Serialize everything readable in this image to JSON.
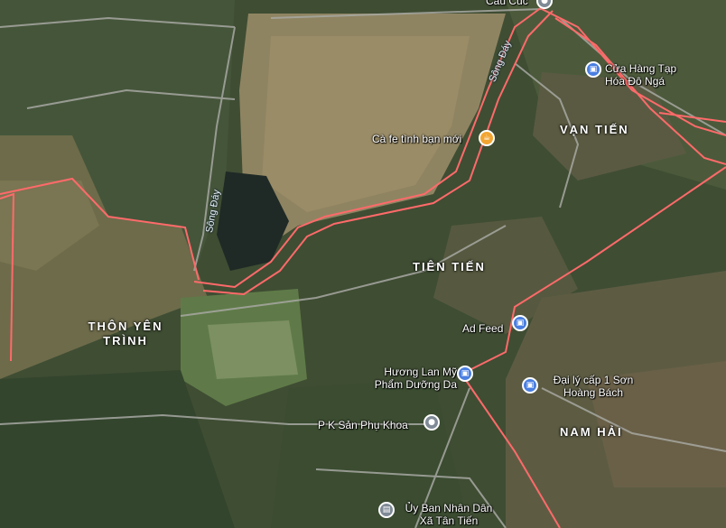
{
  "map": {
    "places": {
      "cau_cuc": "Cầu Cúc",
      "cua_hang": "Cửa Hàng Tạp Hóa Đô Ngá",
      "ca_fe": "Cà fe tình bạn mới",
      "ad_feed": "Ad Feed",
      "huong_lan": "Hương Lan Mỹ Phẩm Dưỡng Da",
      "dai_ly": "Đại lý cấp 1 Sơn Hoàng Bách",
      "pk": "P K Sản Phụ Khoa",
      "uy_ban": "Ủy Ban Nhân Dân Xã Tân Tiến"
    },
    "areas": {
      "van_tien": "VẠN TIẾN",
      "tien_tien": "TIÊN TIẾN",
      "thon_yen_trinh": "THÔN YÊN TRÌNH",
      "nam_hai": "NAM HẢI"
    },
    "rivers": {
      "song_day": "Sông Đáy"
    },
    "icons": {
      "shop": "shopping-bag-icon",
      "cafe": "coffee-cup-icon",
      "clinic": "map-pin-icon",
      "government": "government-building-icon"
    },
    "colors": {
      "boundary": "#ff5a5a",
      "shop_pin": "#4a7fe0",
      "cafe_pin": "#f2a531"
    }
  }
}
